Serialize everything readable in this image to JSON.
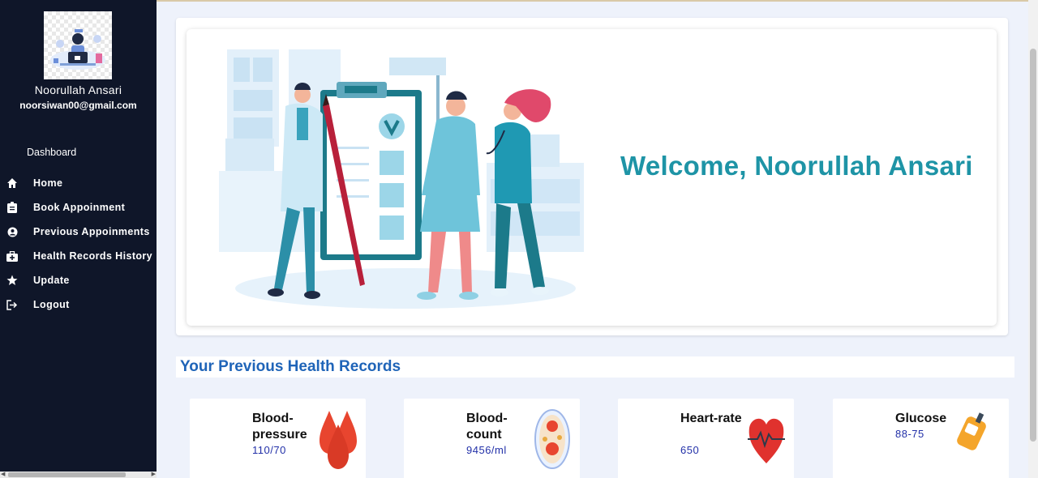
{
  "user": {
    "name": "Noorullah Ansari",
    "email": "noorsiwan00@gmail.com"
  },
  "sidebar": {
    "dashboard_label": "Dashboard",
    "items": [
      {
        "label": "Home",
        "icon": "home-icon"
      },
      {
        "label": "Book Appoinment",
        "icon": "clipboard-icon"
      },
      {
        "label": "Previous Appoinments",
        "icon": "user-circle-icon"
      },
      {
        "label": "Health Records History",
        "icon": "medical-kit-icon"
      },
      {
        "label": "Update",
        "icon": "star-icon"
      },
      {
        "label": "Logout",
        "icon": "logout-icon"
      }
    ]
  },
  "hero": {
    "welcome": "Welcome, Noorullah Ansari"
  },
  "records": {
    "title": "Your Previous Health Records",
    "cards": [
      {
        "name": "Blood-pressure",
        "value": "110/70",
        "icon": "blood-drops-icon"
      },
      {
        "name": "Blood-count",
        "value": "9456/ml",
        "icon": "petri-dish-icon"
      },
      {
        "name": "Heart-rate",
        "value": "650",
        "icon": "heart-pulse-icon"
      },
      {
        "name": "Glucose",
        "value": "88-75",
        "icon": "glucometer-icon"
      }
    ]
  },
  "colors": {
    "sidebar_bg": "#0f1629",
    "accent_teal": "#1e94a6",
    "records_title": "#1f64b8",
    "value_text": "#2230a8"
  }
}
